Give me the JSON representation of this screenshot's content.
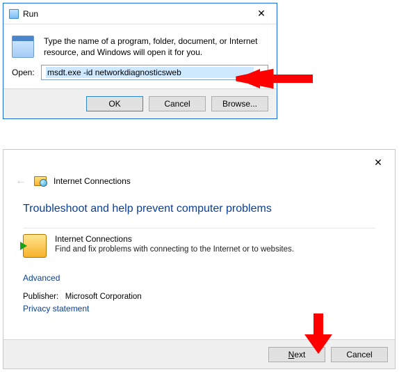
{
  "run": {
    "title": "Run",
    "description": "Type the name of a program, folder, document, or Internet resource, and Windows will open it for you.",
    "open_label": "Open:",
    "open_value": "msdt.exe -id networkdiagnosticsweb",
    "buttons": {
      "ok": "OK",
      "cancel": "Cancel",
      "browse": "Browse..."
    }
  },
  "ts": {
    "header_title": "Internet Connections",
    "heading": "Troubleshoot and help prevent computer problems",
    "item": {
      "name": "Internet Connections",
      "desc": "Find and fix problems with connecting to the Internet or to websites."
    },
    "advanced": "Advanced",
    "publisher_label": "Publisher:",
    "publisher": "Microsoft Corporation",
    "privacy": "Privacy statement",
    "buttons": {
      "next": "Next",
      "next_ul": "N",
      "cancel": "Cancel"
    }
  }
}
